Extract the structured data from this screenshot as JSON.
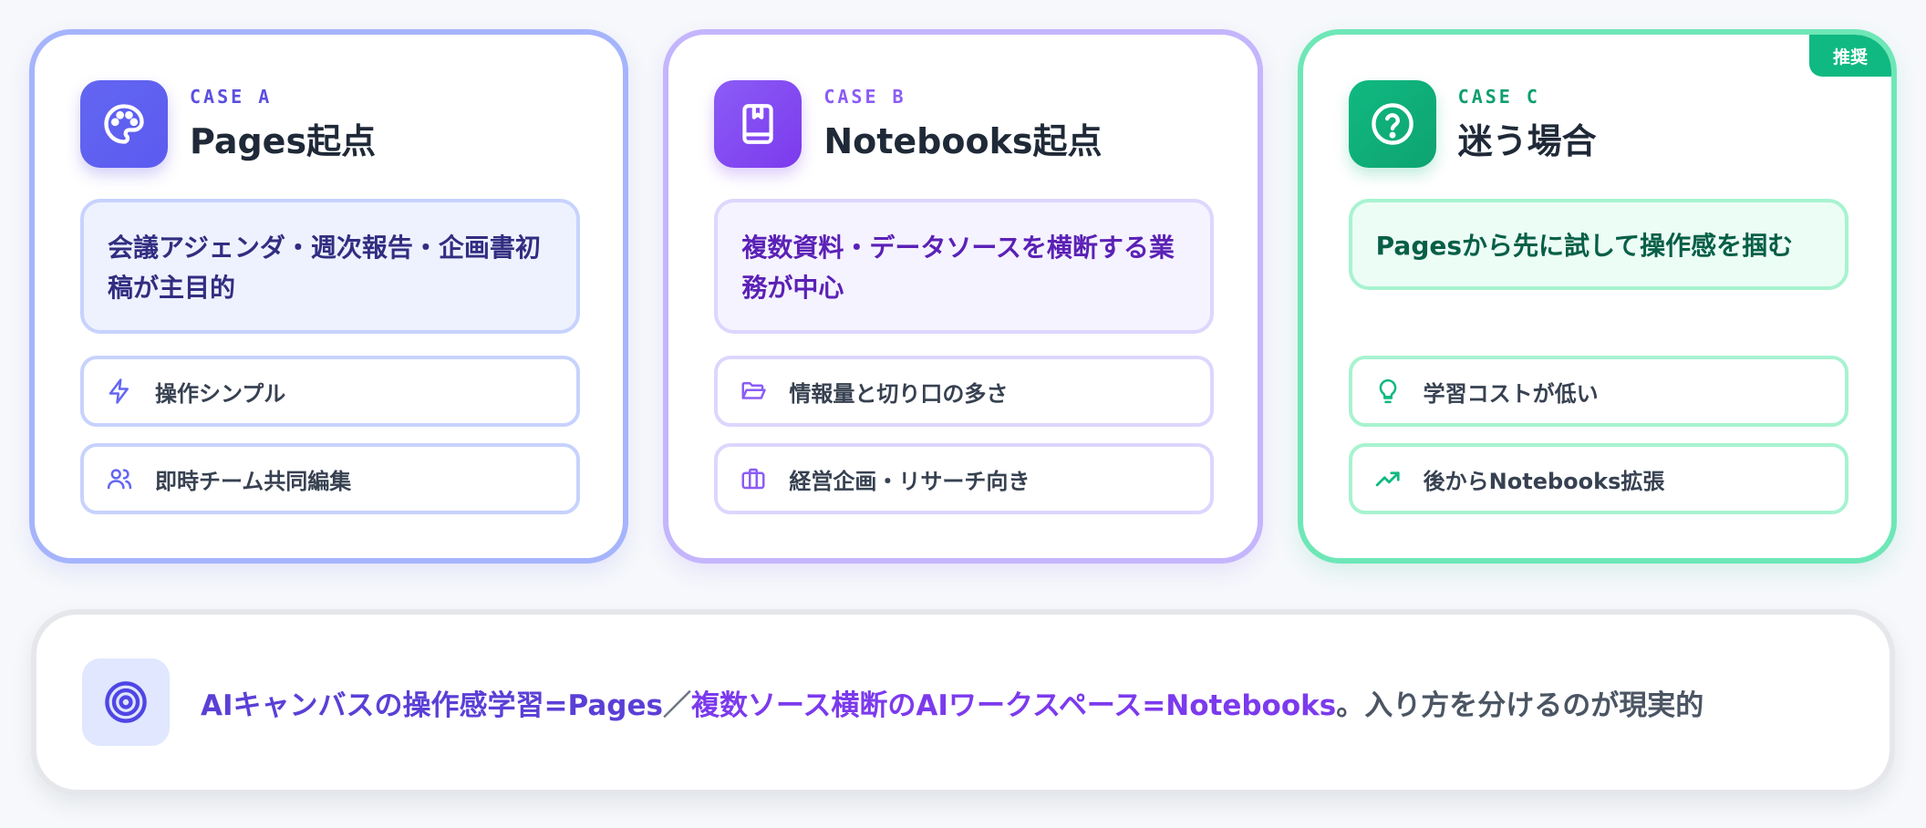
{
  "cards": [
    {
      "id": "a",
      "case_label": "CASE A",
      "title": "Pages起点",
      "icon": "palette-icon",
      "summary": "会議アジェンダ・週次報告・企画書初稿が主目的",
      "features": [
        {
          "icon": "lightning-icon",
          "label": "操作シンプル"
        },
        {
          "icon": "users-icon",
          "label": "即時チーム共同編集"
        }
      ]
    },
    {
      "id": "b",
      "case_label": "CASE B",
      "title": "Notebooks起点",
      "icon": "notebook-icon",
      "summary": "複数資料・データソースを横断する業務が中心",
      "features": [
        {
          "icon": "folder-open-icon",
          "label": "情報量と切り口の多さ"
        },
        {
          "icon": "briefcase-icon",
          "label": "経営企画・リサーチ向き"
        }
      ]
    },
    {
      "id": "c",
      "case_label": "CASE C",
      "title": "迷う場合",
      "icon": "question-circle-icon",
      "badge": "推奨",
      "summary": "Pagesから先に試して操作感を掴む",
      "features": [
        {
          "icon": "lightbulb-icon",
          "label": "学習コストが低い"
        },
        {
          "icon": "trending-up-icon",
          "label": "後からNotebooks拡張"
        }
      ]
    }
  ],
  "conclusion": {
    "icon": "target-icon",
    "part_a": "AIキャンバスの操作感学習=Pages",
    "separator": "／",
    "part_b": "複数ソース横断のAIワークスペース=Notebooks",
    "tail": "。入り方を分けるのが現実的"
  },
  "colors": {
    "case_a": "#6366f1",
    "case_b": "#8b5cf6",
    "case_c": "#10b981"
  }
}
